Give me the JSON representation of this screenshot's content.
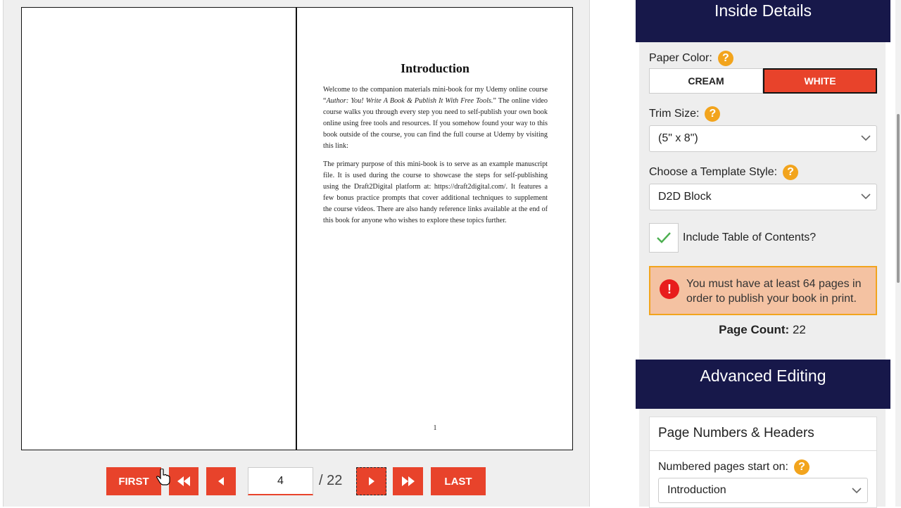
{
  "book": {
    "title": "Introduction",
    "para1_a": "Welcome to the companion materials mini-book for my Udemy online course “",
    "para1_italic": "Author: You! Write A Book & Publish It With Free Tools.",
    "para1_b": "” The online video course walks you through every step you need to self-publish your own book online using free tools and resources. If you somehow found your way to this book outside of the course, you can find the full course at Udemy by visiting this link:",
    "para2": "The primary purpose of this mini-book is to serve as an example manuscript file. It is used during the course to showcase the steps for self-publishing using the Draft2Digital platform at: https://draft2digital.com/. It features a few bonus practice prompts that cover additional techniques to supplement the course videos. There are also handy reference links available at the end of this book for anyone who wishes to explore these topics further.",
    "page_number": "1"
  },
  "nav": {
    "first_label": "FIRST",
    "last_label": "LAST",
    "rewind_icon": "double-chevron-left-icon",
    "prev_icon": "triangle-left-icon",
    "next_icon": "triangle-right-icon",
    "fastforward_icon": "double-chevron-right-icon",
    "current_page": "4",
    "total_pages": "/ 22"
  },
  "inside_details": {
    "heading": "Inside Details",
    "paper_color_label": "Paper Color:",
    "paper_options": [
      "CREAM",
      "WHITE"
    ],
    "paper_selected": "WHITE",
    "trim_size_label": "Trim Size:",
    "trim_size_value": "(5\" x 8\")",
    "template_label": "Choose a Template Style:",
    "template_value": "D2D Block",
    "toc_label": "Include Table of Contents?",
    "toc_checked": true,
    "warning_text": "You must have at least 64 pages in order to publish your book in print.",
    "page_count_label": "Page Count:",
    "page_count_value": "22"
  },
  "advanced": {
    "heading": "Advanced Editing",
    "box_title": "Page Numbers & Headers",
    "numbered_label": "Numbered pages start on:",
    "numbered_value": "Introduction"
  },
  "colors": {
    "accent": "#e8432b",
    "navy": "#17184a",
    "help": "#f2a41d",
    "warning_bg": "#f4c2a2",
    "error": "#e81c1c"
  }
}
